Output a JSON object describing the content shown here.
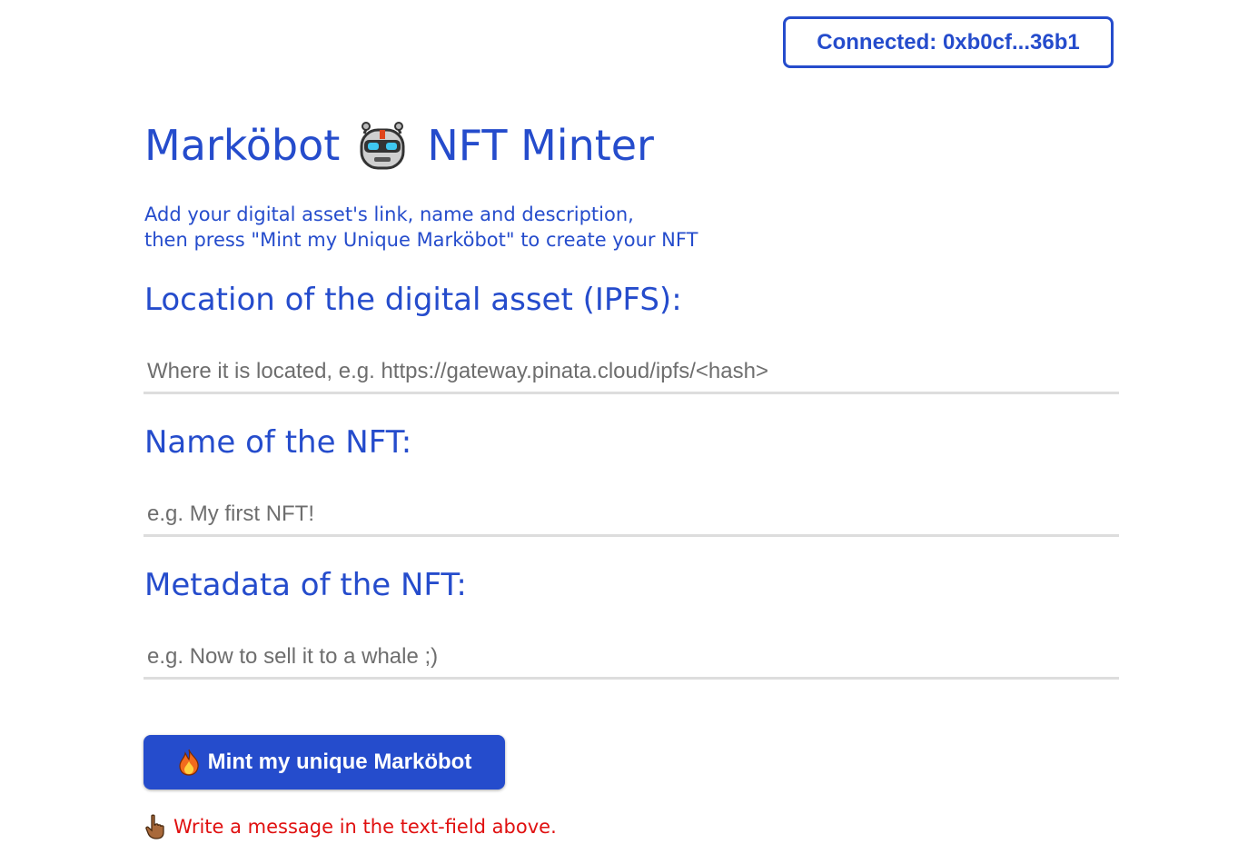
{
  "wallet": {
    "label": "Connected: 0xb0cf...36b1"
  },
  "header": {
    "title_part1": "Marköbot",
    "title_icon": "robot-icon",
    "title_part2": "NFT Minter"
  },
  "intro": {
    "line1": "Add your digital asset's link, name and description,",
    "line2": "then press \"Mint my Unique Marköbot\" to create your NFT"
  },
  "form": {
    "url": {
      "label": "Location of the digital asset (IPFS):",
      "placeholder": "Where it is located, e.g. https://gateway.pinata.cloud/ipfs/<hash>",
      "value": ""
    },
    "name": {
      "label": "Name of the NFT:",
      "placeholder": "e.g. My first NFT!",
      "value": ""
    },
    "description": {
      "label": "Metadata of the NFT:",
      "placeholder": "e.g. Now to sell it to a whale ;)",
      "value": ""
    }
  },
  "mint_button": {
    "icon": "fire-icon",
    "label": "Mint my unique Marköbot"
  },
  "status": {
    "icon": "pointing-hand-icon",
    "message": "Write a message in the text-field above."
  },
  "colors": {
    "accent": "#254ccc",
    "error": "#e01010",
    "input_border": "#dddddd",
    "placeholder": "#6e6e6e"
  }
}
